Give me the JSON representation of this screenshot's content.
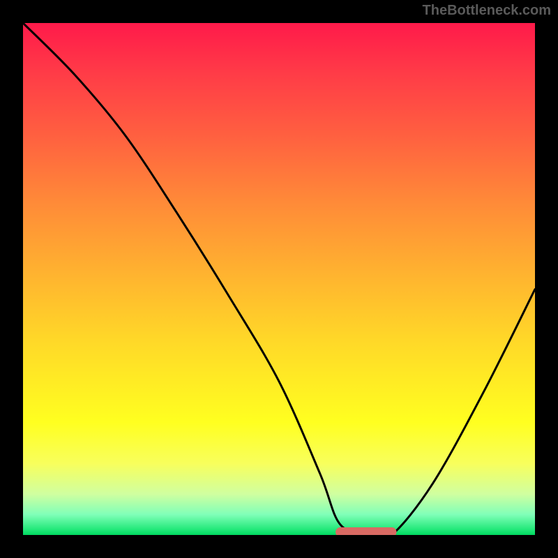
{
  "watermark": "TheBottleneck.com",
  "chart_data": {
    "type": "line",
    "title": "",
    "xlabel": "",
    "ylabel": "",
    "xlim": [
      0,
      100
    ],
    "ylim": [
      0,
      100
    ],
    "series": [
      {
        "name": "bottleneck-curve",
        "x": [
          0,
          10,
          20,
          30,
          40,
          50,
          58,
          62,
          68,
          72,
          80,
          90,
          100
        ],
        "y": [
          100,
          90,
          78,
          63,
          47,
          30,
          12,
          2,
          0,
          0,
          10,
          28,
          48
        ]
      }
    ],
    "highlight": {
      "name": "optimal-range",
      "x": [
        62,
        72
      ],
      "y": [
        0,
        0
      ]
    },
    "gradient_stops": [
      {
        "pos": 0,
        "color": "#ff1a4a"
      },
      {
        "pos": 22,
        "color": "#ff6040"
      },
      {
        "pos": 48,
        "color": "#ffb030"
      },
      {
        "pos": 78,
        "color": "#ffff20"
      },
      {
        "pos": 96,
        "color": "#80ffb8"
      },
      {
        "pos": 100,
        "color": "#00d860"
      }
    ]
  }
}
